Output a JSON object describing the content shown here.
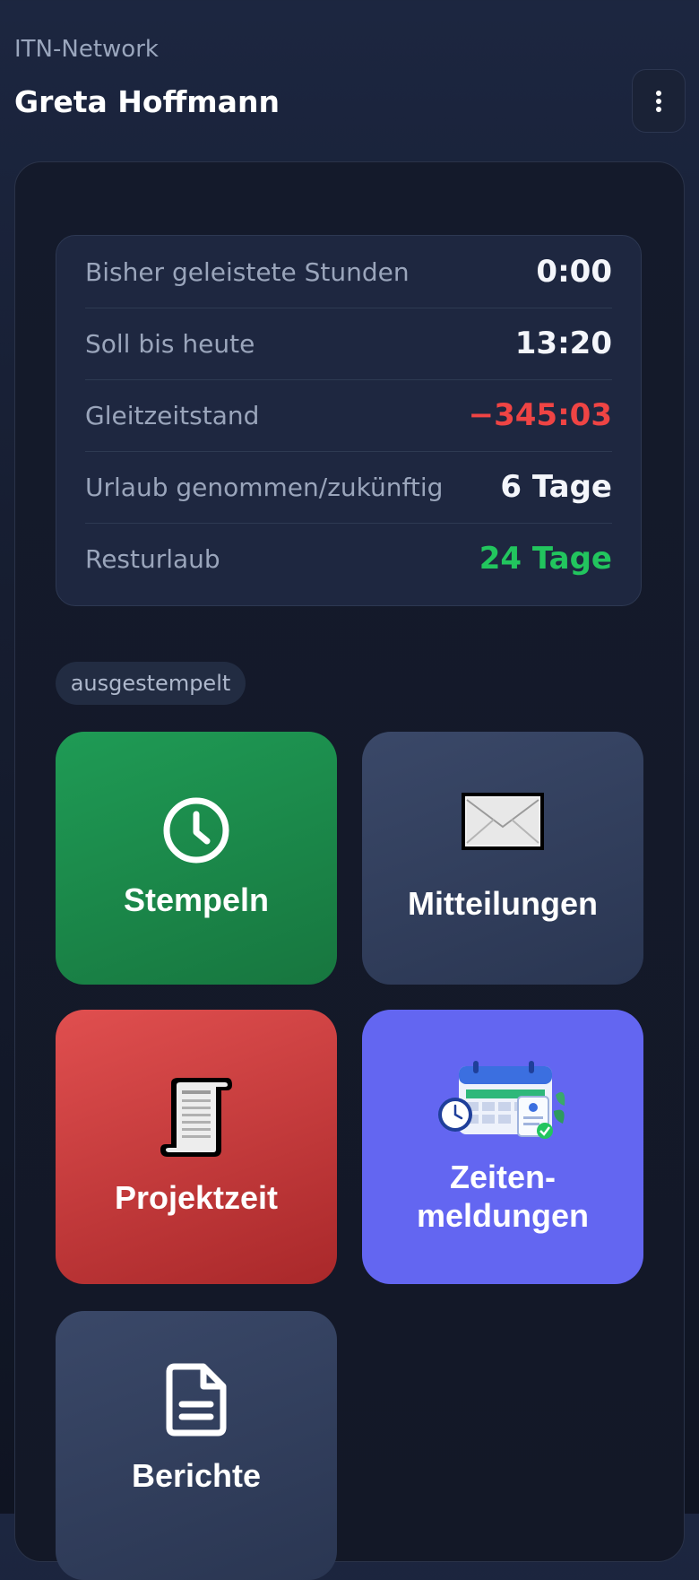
{
  "header": {
    "organization": "ITN-Network",
    "user_name": "Greta Hoffmann",
    "menu_icon": "more-vertical-icon"
  },
  "stats": [
    {
      "label": "Bisher geleistete Stunden",
      "value": "0:00",
      "tone": "neutral"
    },
    {
      "label": "Soll bis heute",
      "value": "13:20",
      "tone": "neutral"
    },
    {
      "label": "Gleitzeitstand",
      "value": "−345:03",
      "tone": "negative"
    },
    {
      "label": "Urlaub genommen/zukünftig",
      "value": "6 Tage",
      "tone": "neutral"
    },
    {
      "label": "Resturlaub",
      "value": "24 Tage",
      "tone": "positive"
    }
  ],
  "status_badge": "ausgestempelt",
  "tiles": {
    "stempeln": {
      "label": "Stempeln",
      "icon": "clock-icon",
      "color": "#1f9b55"
    },
    "mitteilungen": {
      "label": "Mitteilungen",
      "icon": "envelope-icon",
      "color": "#34405c"
    },
    "projektzeit": {
      "label": "Projektzeit",
      "icon": "scroll-icon",
      "color": "#d04444"
    },
    "zeitenmeldungen": {
      "label_line1": "Zeiten-",
      "label_line2": "meldungen",
      "icon": "calendar-icon",
      "color": "#6366f1"
    },
    "berichte": {
      "label": "Berichte",
      "icon": "document-icon",
      "color": "#34405c"
    }
  },
  "colors": {
    "negative": "#ef4444",
    "positive": "#22c55e",
    "background": "#161d30"
  }
}
